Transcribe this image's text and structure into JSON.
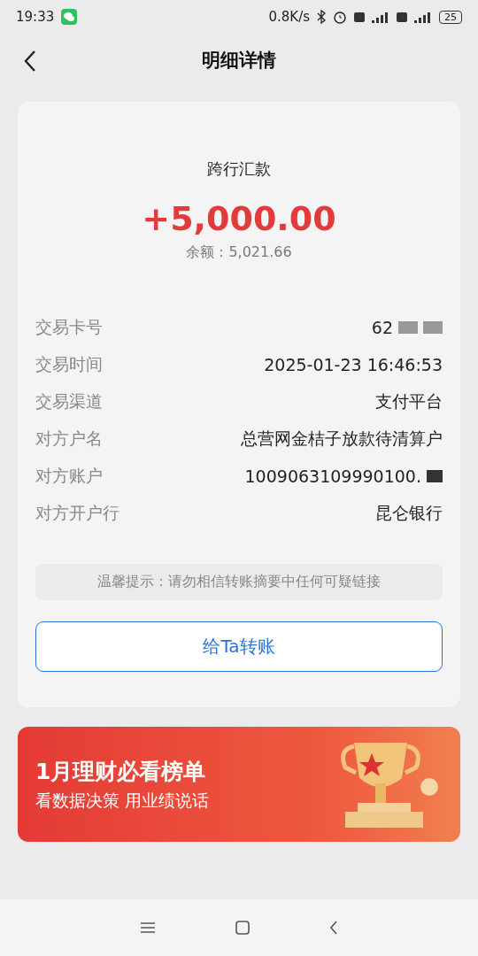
{
  "status_bar": {
    "time": "19:33",
    "speed": "0.8K/s",
    "battery": "25"
  },
  "header": {
    "title": "明细详情"
  },
  "summary": {
    "type": "跨行汇款",
    "amount": "+5,000.00",
    "balance_label": "余额：",
    "balance": "5,021.66"
  },
  "details": [
    {
      "label": "交易卡号",
      "value": "62",
      "masked": true
    },
    {
      "label": "交易时间",
      "value": "2025-01-23 16:46:53",
      "masked": false
    },
    {
      "label": "交易渠道",
      "value": "支付平台",
      "masked": false
    },
    {
      "label": "对方户名",
      "value": "总营网金桔子放款待清算户",
      "masked": false
    },
    {
      "label": "对方账户",
      "value": "1009063109990100.",
      "masked": true
    },
    {
      "label": "对方开户行",
      "value": "昆仑银行",
      "masked": false
    }
  ],
  "tip": "温馨提示：请勿相信转账摘要中任何可疑链接",
  "transfer_button": "给Ta转账",
  "banner": {
    "title": "1月理财必看榜单",
    "subtitle": "看数据决策 用业绩说话"
  }
}
